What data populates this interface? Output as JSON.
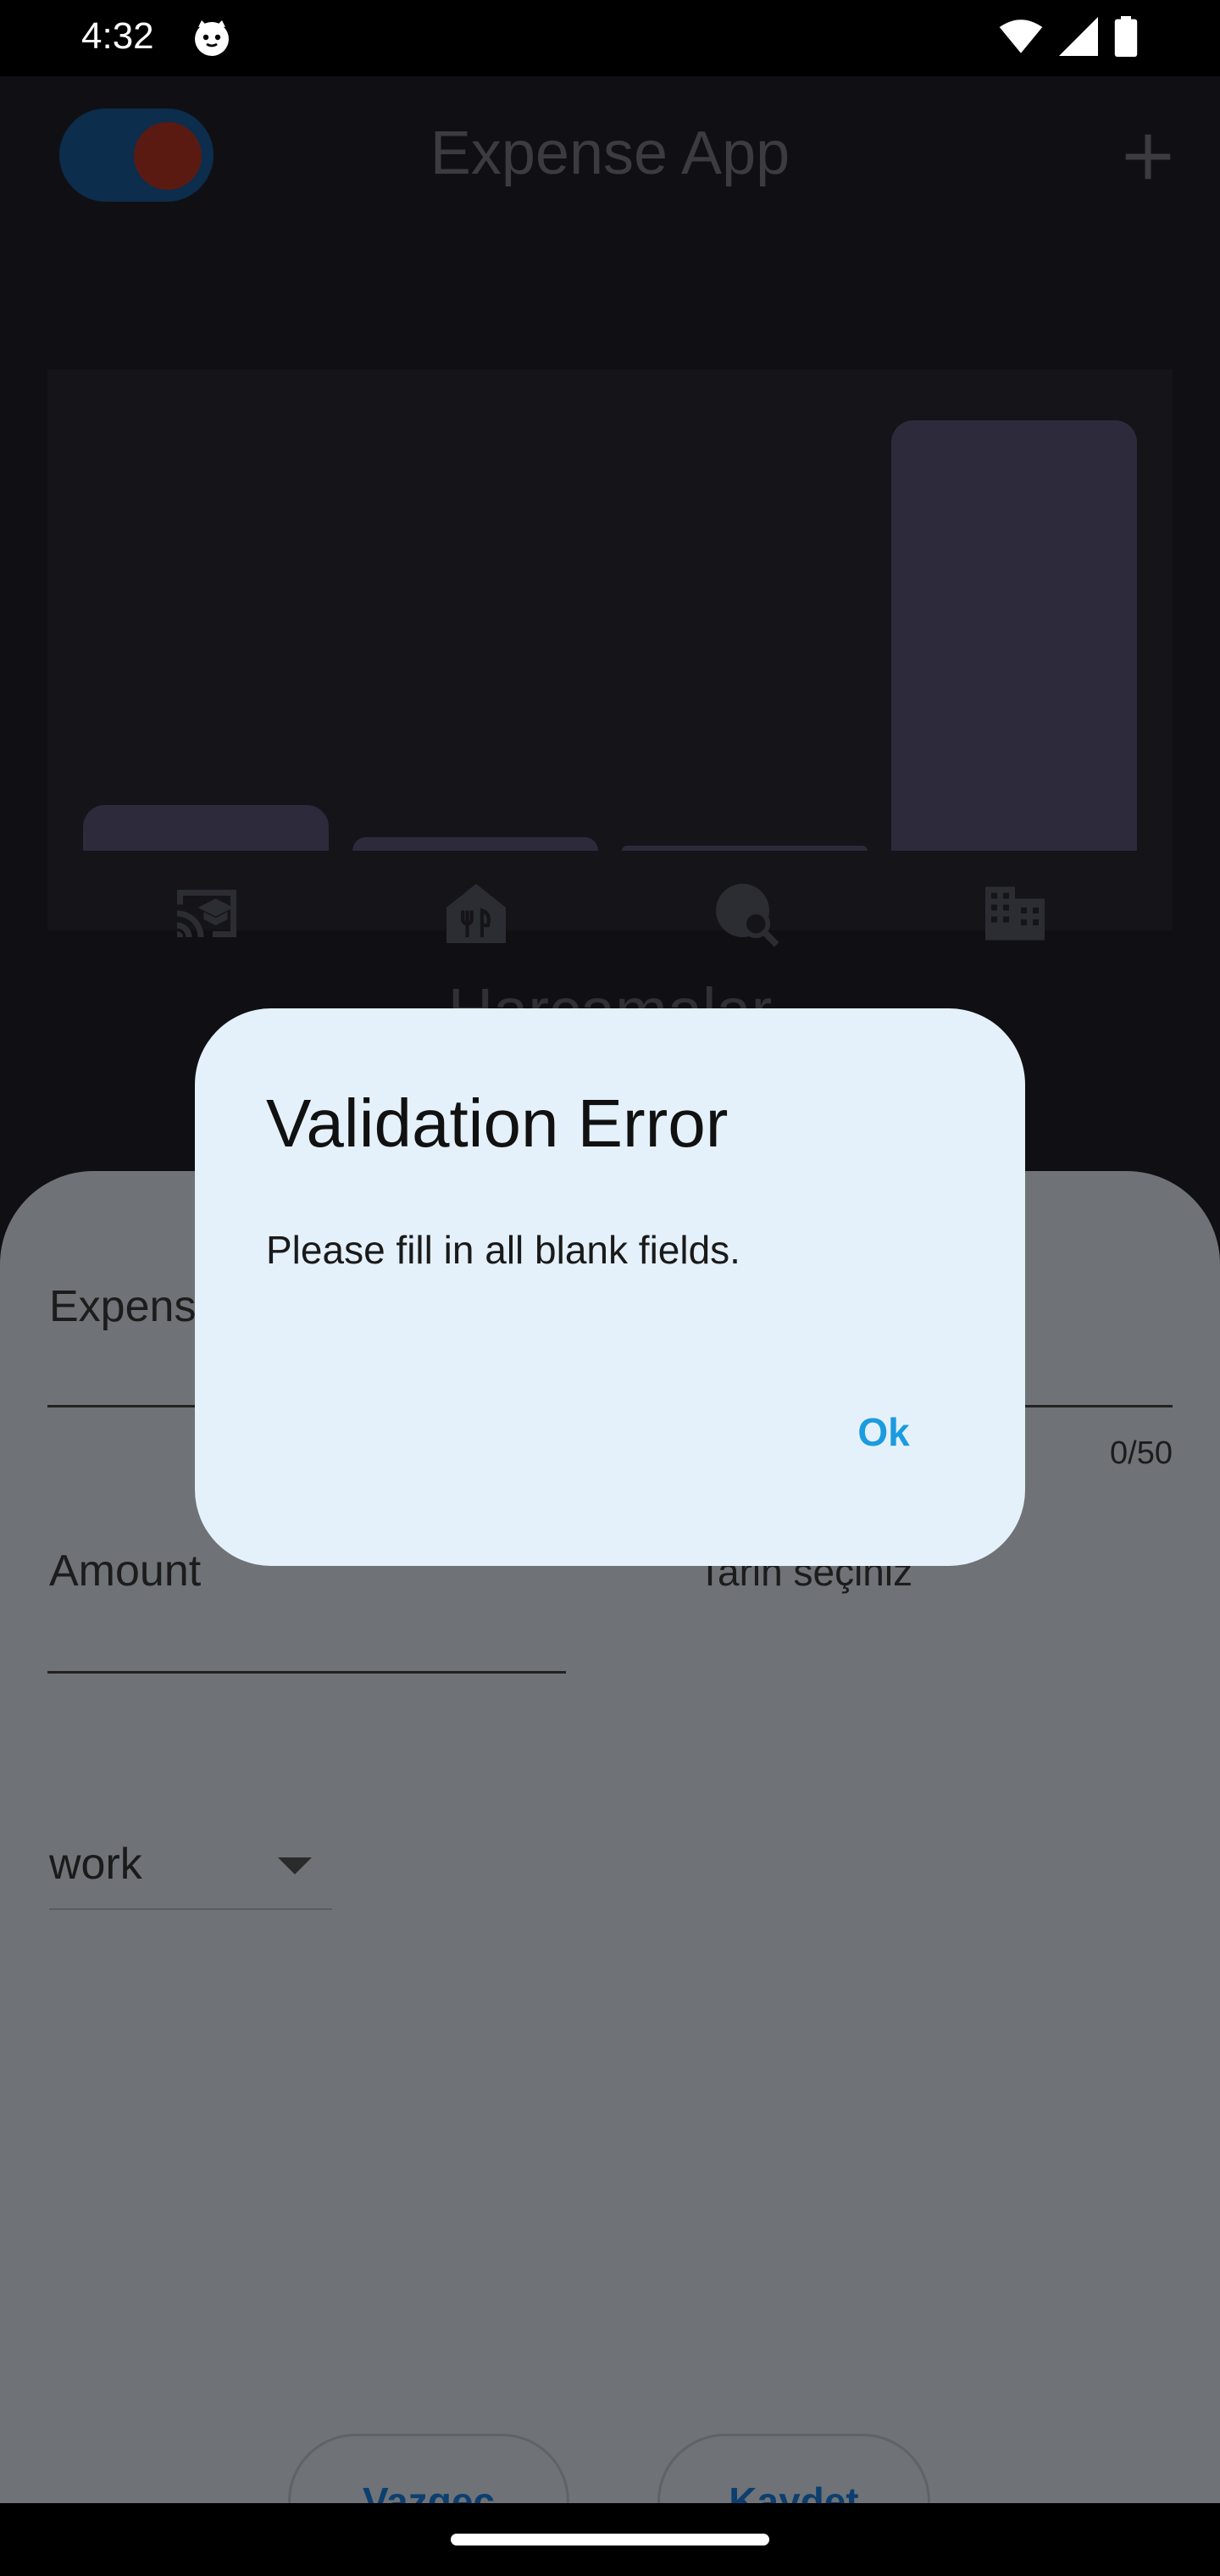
{
  "status_bar": {
    "time": "4:32",
    "icons": [
      "cat-icon",
      "wifi-icon",
      "signal-icon",
      "battery-icon"
    ]
  },
  "app": {
    "title": "Expense App",
    "heading": "Harcamalar",
    "chart": {
      "categories": [
        "leisure",
        "food",
        "travel",
        "work"
      ],
      "fill_fraction": [
        0.05,
        0.01,
        0.005,
        1.0
      ],
      "icons": [
        "leisure-icon",
        "food-icon",
        "travel-icon",
        "work-icon"
      ]
    }
  },
  "sheet": {
    "title_label": "Expense Title",
    "title_counter": "0/50",
    "amount_label": "Amount",
    "date_label": "Tarih seçiniz",
    "category_value": "work",
    "cancel_label": "Vazgeç",
    "save_label": "Kaydet"
  },
  "dialog": {
    "title": "Validation Error",
    "message": "Please fill in all blank fields.",
    "ok_label": "Ok"
  },
  "colors": {
    "dialog_bg": "#e5f1fa",
    "accent": "#1b9be0",
    "scrim_sheet": "#6f7276"
  }
}
